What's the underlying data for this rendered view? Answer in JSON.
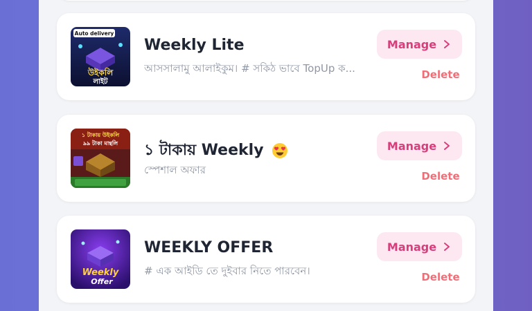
{
  "colors": {
    "background": "#6a6fd6",
    "card": "#ffffff",
    "title": "#1f2533",
    "description": "#9097a4",
    "manage_bg": "#fde8f1",
    "manage_text": "#d63f7c",
    "delete_text": "#ef6f78"
  },
  "offers": [
    {
      "title": "Weekly Lite",
      "title_emoji": "",
      "description": "আসসালামু আলাইকুম। # সকিঠ ভাবে TopUp ক...",
      "thumb": {
        "icon": "weekly-lite-thumbnail",
        "badge": "Auto delivery",
        "caption_line1": "উইকলি",
        "caption_line2": "লাইট"
      },
      "manage_label": "Manage",
      "delete_label": "Delete"
    },
    {
      "title": "১ টাকায় Weekly",
      "title_emoji": "😍",
      "description": "স্পেশাল অফার",
      "thumb": {
        "icon": "one-taka-weekly-thumbnail",
        "caption_line1": "১ টাকায় উইকলি",
        "caption_line2": "৯৯ টাকা মান্থলি"
      },
      "manage_label": "Manage",
      "delete_label": "Delete"
    },
    {
      "title": "WEEKLY OFFER",
      "title_emoji": "",
      "description": "# এক আইডি তে দুইবার নিতে পারবেন।",
      "thumb": {
        "icon": "weekly-offer-thumbnail",
        "caption_line1": "Weekly",
        "caption_line2": "Offer"
      },
      "manage_label": "Manage",
      "delete_label": "Delete"
    }
  ]
}
